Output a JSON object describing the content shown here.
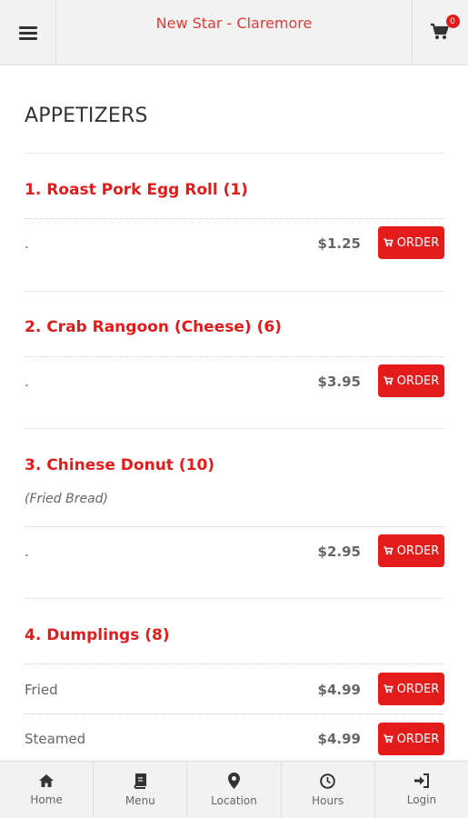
{
  "header": {
    "title": "New Star - Claremore",
    "cart_count": "0"
  },
  "section": {
    "title": "APPETIZERS"
  },
  "order_label": "ORDER",
  "items": [
    {
      "name": "1. Roast Pork Egg Roll (1)",
      "variants": [
        {
          "label": ".",
          "price": "$1.25"
        }
      ]
    },
    {
      "name": "2. Crab Rangoon (Cheese) (6)",
      "variants": [
        {
          "label": ".",
          "price": "$3.95"
        }
      ]
    },
    {
      "name": "3. Chinese Donut (10)",
      "desc": "(Fried Bread)",
      "variants": [
        {
          "label": ".",
          "price": "$2.95"
        }
      ]
    },
    {
      "name": "4. Dumplings (8)",
      "variants": [
        {
          "label": "Fried",
          "price": "$4.99"
        },
        {
          "label": "Steamed",
          "price": "$4.99"
        }
      ]
    }
  ],
  "nav": [
    {
      "label": "Home",
      "icon": "home-icon"
    },
    {
      "label": "Menu",
      "icon": "book-icon"
    },
    {
      "label": "Location",
      "icon": "map-marker-icon"
    },
    {
      "label": "Hours",
      "icon": "clock-icon"
    },
    {
      "label": "Login",
      "icon": "sign-in-icon"
    }
  ]
}
